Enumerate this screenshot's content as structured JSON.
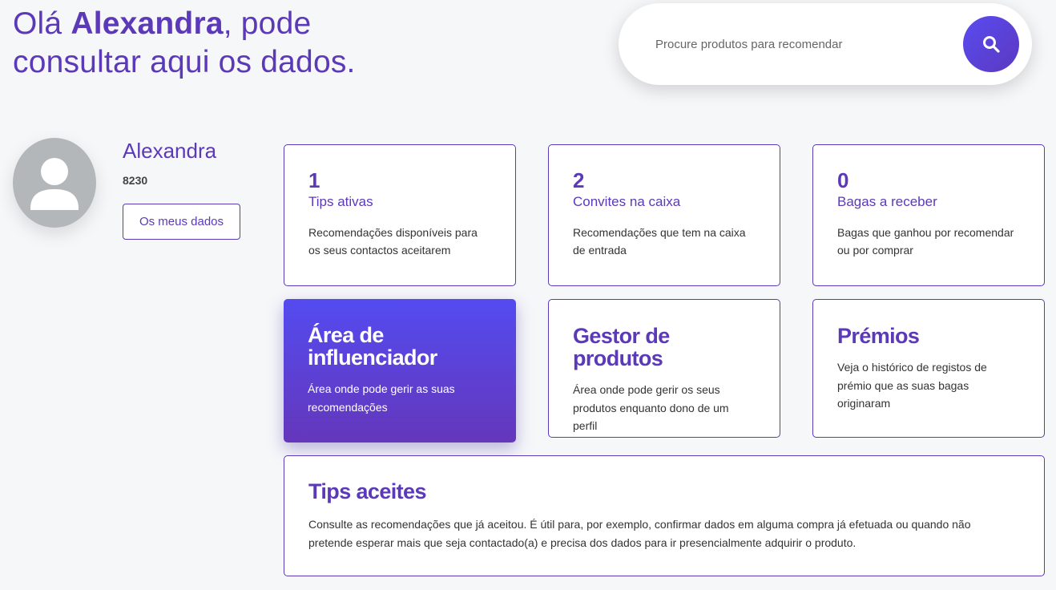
{
  "greeting": {
    "prefix": "Olá ",
    "name": "Alexandra",
    "suffix": ", pode",
    "line2": "consultar aqui os dados."
  },
  "search": {
    "placeholder": "Procure produtos para recomendar",
    "button_icon": "search-icon"
  },
  "profile": {
    "avatar_icon": "user-avatar-icon",
    "name": "Alexandra",
    "id": "8230",
    "my_data_label": "Os meus dados"
  },
  "stats": [
    {
      "value": "1",
      "label": "Tips ativas",
      "description": "Recomendações disponíveis para os seus contactos aceitarem"
    },
    {
      "value": "2",
      "label": "Convites na caixa",
      "description": "Recomendações que tem na caixa de entrada"
    },
    {
      "value": "0",
      "label": "Bagas a receber",
      "description": "Bagas que ganhou por recomendar ou por comprar"
    }
  ],
  "sections": [
    {
      "title": "Área de influenciador",
      "description": "Área onde pode gerir as suas recomendações"
    },
    {
      "title": "Gestor de produtos",
      "description": "Área onde pode gerir os seus produtos enquanto dono de um perfil"
    },
    {
      "title": "Prémios",
      "description": "Veja o histórico de registos de prémio que as suas bagas originaram"
    },
    {
      "title": "Tips aceites",
      "description": "Consulte as recomendações que já aceitou. É útil para, por exemplo, confirmar dados em alguma compra já efetuada ou quando não pretende esperar mais que seja contactado(a) e precisa dos dados para ir presencialmente adquirir o produto."
    }
  ],
  "colors": {
    "accent": "#5b39b8",
    "gradient_start": "#544bf0",
    "gradient_end": "#6437bb",
    "avatar_bg": "#b4b7ba",
    "page_bg": "#f6f7f9"
  }
}
